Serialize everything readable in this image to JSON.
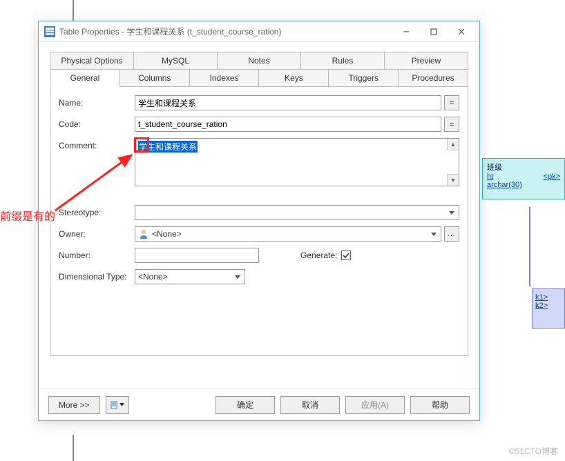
{
  "window": {
    "title": "Table Properties - 学生和课程关系 (t_student_course_ration)"
  },
  "tabs": {
    "row1": [
      "Physical Options",
      "MySQL",
      "Notes",
      "Rules",
      "Preview"
    ],
    "row2": [
      "General",
      "Columns",
      "Indexes",
      "Keys",
      "Triggers",
      "Procedures"
    ],
    "active": "General"
  },
  "general": {
    "name_label": "Name:",
    "name_value": "学生和课程关系",
    "code_label": "Code:",
    "code_value": "t_student_course_ration",
    "comment_label": "Comment:",
    "comment_value": "学生和课程关系",
    "stereotype_label": "Stereotype:",
    "stereotype_value": "",
    "owner_label": "Owner:",
    "owner_value": "<None>",
    "number_label": "Number:",
    "number_value": "",
    "generate_label": "Generate:",
    "dimtype_label": "Dimensional Type:",
    "dimtype_value": "<None>",
    "eq": "="
  },
  "buttons": {
    "more": "More >>",
    "ok": "确定",
    "cancel": "取消",
    "apply": "应用(A)",
    "help": "帮助"
  },
  "annotation": {
    "text": "前缀是有的"
  },
  "bg": {
    "box1_title": "班级",
    "box1_line1": "ht",
    "box1_line2": "archar(30)",
    "box1_pk": "<pk>",
    "box2_l1": "k1>",
    "box2_l2": "k2>"
  },
  "watermark": "©51CTO博客"
}
